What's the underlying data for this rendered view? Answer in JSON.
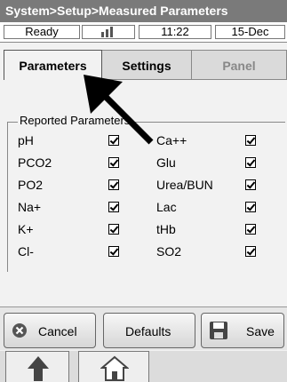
{
  "title": "System>Setup>Measured Parameters",
  "status": {
    "state": "Ready",
    "time": "11:22",
    "date": "15-Dec",
    "signal_icon": "signal-icon"
  },
  "tabs": [
    {
      "label": "Parameters",
      "active": true
    },
    {
      "label": "Settings",
      "active": false
    },
    {
      "label": "Panel",
      "active": false,
      "disabled": true
    }
  ],
  "group_label": "Reported Parameters",
  "params_left": [
    {
      "name": "pH",
      "checked": true
    },
    {
      "name": "PCO2",
      "checked": true
    },
    {
      "name": "PO2",
      "checked": true
    },
    {
      "name": "Na+",
      "checked": true
    },
    {
      "name": "K+",
      "checked": true
    },
    {
      "name": "Cl-",
      "checked": true
    }
  ],
  "params_right": [
    {
      "name": "Ca++",
      "checked": true
    },
    {
      "name": "Glu",
      "checked": true
    },
    {
      "name": "Urea/BUN",
      "checked": true
    },
    {
      "name": "Lac",
      "checked": true
    },
    {
      "name": "tHb",
      "checked": true
    },
    {
      "name": "SO2",
      "checked": true
    }
  ],
  "buttons": {
    "cancel": "Cancel",
    "defaults": "Defaults",
    "save": "Save"
  },
  "nav": {
    "up_icon": "up-arrow-icon",
    "home_icon": "home-icon"
  },
  "annotation": {
    "icon": "pointer-arrow-icon",
    "color": "#000000"
  }
}
